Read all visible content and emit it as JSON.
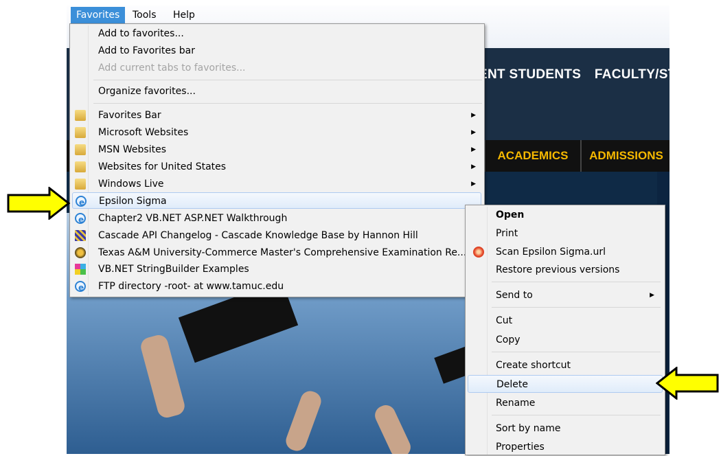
{
  "menubar": {
    "items": [
      {
        "label": "Favorites",
        "active": true
      },
      {
        "label": "Tools",
        "active": false
      },
      {
        "label": "Help",
        "active": false
      }
    ]
  },
  "site": {
    "top_nav": [
      "ENT STUDENTS",
      "FACULTY/STA"
    ],
    "main_nav": [
      "ACADEMICS",
      "ADMISSIONS"
    ]
  },
  "favorites_menu": {
    "add_to_favorites": "Add to favorites...",
    "add_to_favorites_bar": "Add to Favorites bar",
    "add_current_tabs": "Add current tabs to favorites...",
    "organize": "Organize favorites...",
    "folders": [
      {
        "label": "Favorites Bar",
        "icon": "folder-icon"
      },
      {
        "label": "Microsoft Websites",
        "icon": "folder-icon"
      },
      {
        "label": "MSN Websites",
        "icon": "folder-icon"
      },
      {
        "label": "Websites for United States",
        "icon": "folder-icon"
      },
      {
        "label": "Windows Live",
        "icon": "folder-icon"
      }
    ],
    "links": [
      {
        "label": "Epsilon Sigma",
        "icon": "ie-page-icon"
      },
      {
        "label": "Chapter2 VB.NET ASP.NET Walkthrough",
        "icon": "ie-page-icon"
      },
      {
        "label": "Cascade API Changelog - Cascade Knowledge Base by Hannon Hill",
        "icon": "cascade-icon"
      },
      {
        "label": "Texas A&M University-Commerce Master's Comprehensive Examination Re...",
        "icon": "tamuc-icon"
      },
      {
        "label": "VB.NET StringBuilder Examples",
        "icon": "multicolor-icon"
      },
      {
        "label": "FTP directory -root- at www.tamuc.edu",
        "icon": "ie-page-icon"
      }
    ]
  },
  "context_menu": {
    "open": "Open",
    "print": "Print",
    "scan": "Scan Epsilon Sigma.url",
    "restore": "Restore previous versions",
    "send_to": "Send to",
    "cut": "Cut",
    "copy": "Copy",
    "create_shortcut": "Create shortcut",
    "delete": "Delete",
    "rename": "Rename",
    "sort_by_name": "Sort by name",
    "properties": "Properties"
  },
  "colors": {
    "menu_bg": "#f1f1f1",
    "highlight": "#3b8fd9",
    "arrow_fill": "#ffff00",
    "site_header": "#1b2f45",
    "nav_gold": "#f5b800"
  }
}
